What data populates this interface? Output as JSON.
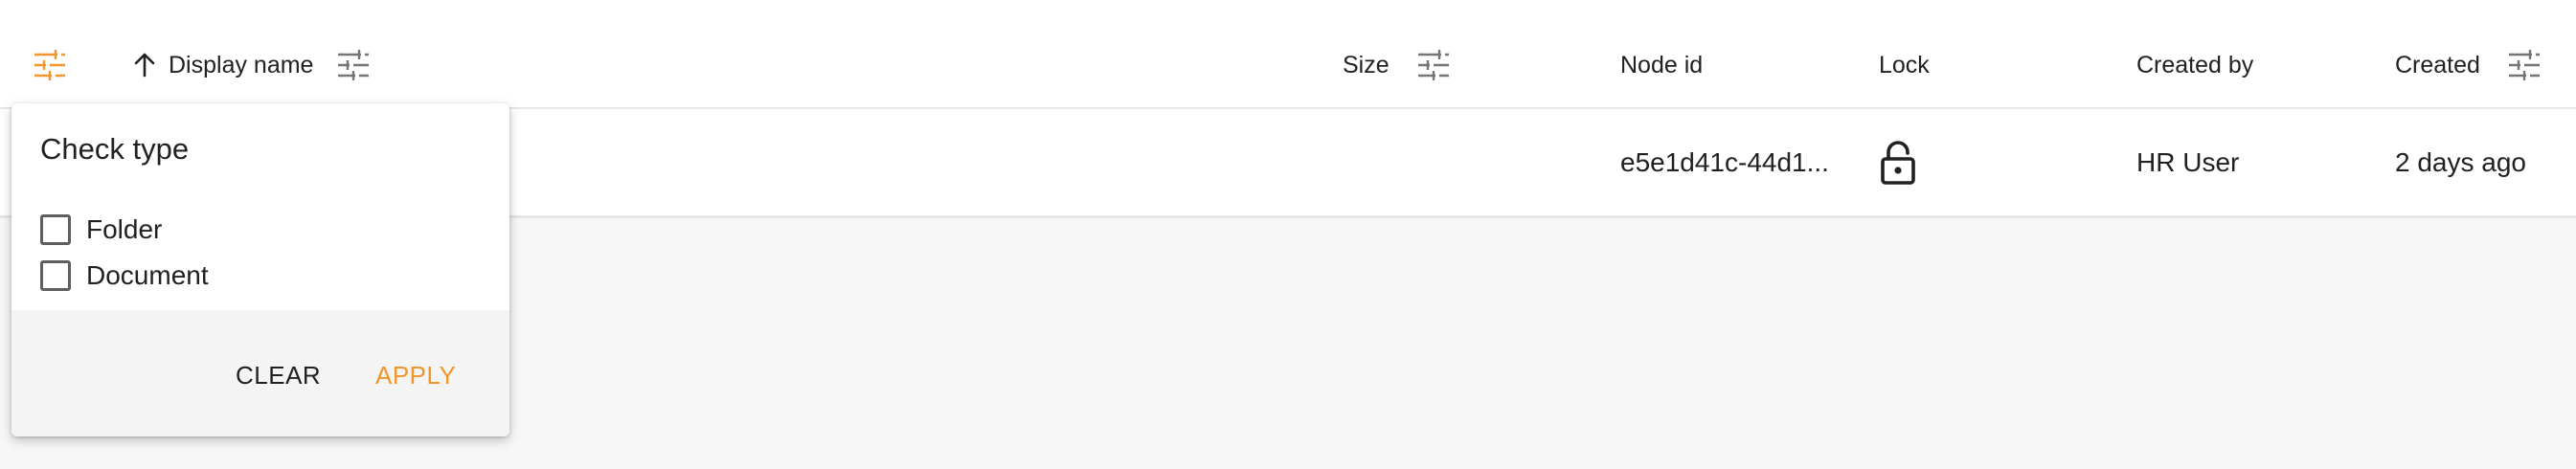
{
  "colors": {
    "accent": "#f0962a",
    "text": "#212121",
    "icon_gray": "#757575"
  },
  "table": {
    "columns": {
      "type_filter_icon": "filter-icon",
      "sort_icon": "arrow-up-icon",
      "display_name": "Display name",
      "size": "Size",
      "node_id": "Node id",
      "lock": "Lock",
      "created_by": "Created by",
      "created": "Created"
    },
    "rows": [
      {
        "node_id": "e5e1d41c-44d1...",
        "lock_icon": "lock-open-icon",
        "created_by": "HR User",
        "created": "2 days ago"
      }
    ]
  },
  "filter_popup": {
    "title": "Check type",
    "options": [
      {
        "label": "Folder",
        "checked": false
      },
      {
        "label": "Document",
        "checked": false
      }
    ],
    "clear_label": "CLEAR",
    "apply_label": "APPLY"
  }
}
